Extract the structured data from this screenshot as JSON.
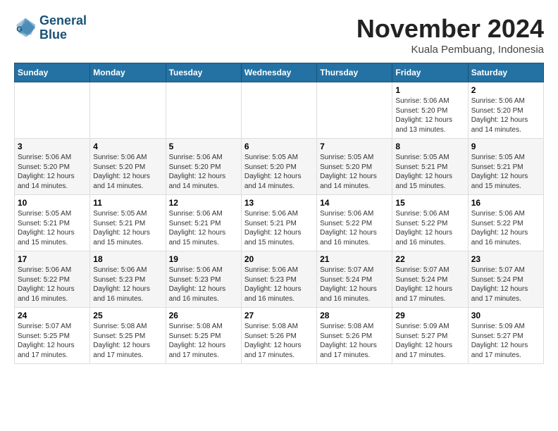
{
  "header": {
    "logo_line1": "General",
    "logo_line2": "Blue",
    "month": "November 2024",
    "location": "Kuala Pembuang, Indonesia"
  },
  "days_of_week": [
    "Sunday",
    "Monday",
    "Tuesday",
    "Wednesday",
    "Thursday",
    "Friday",
    "Saturday"
  ],
  "weeks": [
    [
      {
        "day": "",
        "info": ""
      },
      {
        "day": "",
        "info": ""
      },
      {
        "day": "",
        "info": ""
      },
      {
        "day": "",
        "info": ""
      },
      {
        "day": "",
        "info": ""
      },
      {
        "day": "1",
        "info": "Sunrise: 5:06 AM\nSunset: 5:20 PM\nDaylight: 12 hours\nand 13 minutes."
      },
      {
        "day": "2",
        "info": "Sunrise: 5:06 AM\nSunset: 5:20 PM\nDaylight: 12 hours\nand 14 minutes."
      }
    ],
    [
      {
        "day": "3",
        "info": "Sunrise: 5:06 AM\nSunset: 5:20 PM\nDaylight: 12 hours\nand 14 minutes."
      },
      {
        "day": "4",
        "info": "Sunrise: 5:06 AM\nSunset: 5:20 PM\nDaylight: 12 hours\nand 14 minutes."
      },
      {
        "day": "5",
        "info": "Sunrise: 5:06 AM\nSunset: 5:20 PM\nDaylight: 12 hours\nand 14 minutes."
      },
      {
        "day": "6",
        "info": "Sunrise: 5:05 AM\nSunset: 5:20 PM\nDaylight: 12 hours\nand 14 minutes."
      },
      {
        "day": "7",
        "info": "Sunrise: 5:05 AM\nSunset: 5:20 PM\nDaylight: 12 hours\nand 14 minutes."
      },
      {
        "day": "8",
        "info": "Sunrise: 5:05 AM\nSunset: 5:21 PM\nDaylight: 12 hours\nand 15 minutes."
      },
      {
        "day": "9",
        "info": "Sunrise: 5:05 AM\nSunset: 5:21 PM\nDaylight: 12 hours\nand 15 minutes."
      }
    ],
    [
      {
        "day": "10",
        "info": "Sunrise: 5:05 AM\nSunset: 5:21 PM\nDaylight: 12 hours\nand 15 minutes."
      },
      {
        "day": "11",
        "info": "Sunrise: 5:05 AM\nSunset: 5:21 PM\nDaylight: 12 hours\nand 15 minutes."
      },
      {
        "day": "12",
        "info": "Sunrise: 5:06 AM\nSunset: 5:21 PM\nDaylight: 12 hours\nand 15 minutes."
      },
      {
        "day": "13",
        "info": "Sunrise: 5:06 AM\nSunset: 5:21 PM\nDaylight: 12 hours\nand 15 minutes."
      },
      {
        "day": "14",
        "info": "Sunrise: 5:06 AM\nSunset: 5:22 PM\nDaylight: 12 hours\nand 16 minutes."
      },
      {
        "day": "15",
        "info": "Sunrise: 5:06 AM\nSunset: 5:22 PM\nDaylight: 12 hours\nand 16 minutes."
      },
      {
        "day": "16",
        "info": "Sunrise: 5:06 AM\nSunset: 5:22 PM\nDaylight: 12 hours\nand 16 minutes."
      }
    ],
    [
      {
        "day": "17",
        "info": "Sunrise: 5:06 AM\nSunset: 5:22 PM\nDaylight: 12 hours\nand 16 minutes."
      },
      {
        "day": "18",
        "info": "Sunrise: 5:06 AM\nSunset: 5:23 PM\nDaylight: 12 hours\nand 16 minutes."
      },
      {
        "day": "19",
        "info": "Sunrise: 5:06 AM\nSunset: 5:23 PM\nDaylight: 12 hours\nand 16 minutes."
      },
      {
        "day": "20",
        "info": "Sunrise: 5:06 AM\nSunset: 5:23 PM\nDaylight: 12 hours\nand 16 minutes."
      },
      {
        "day": "21",
        "info": "Sunrise: 5:07 AM\nSunset: 5:24 PM\nDaylight: 12 hours\nand 16 minutes."
      },
      {
        "day": "22",
        "info": "Sunrise: 5:07 AM\nSunset: 5:24 PM\nDaylight: 12 hours\nand 17 minutes."
      },
      {
        "day": "23",
        "info": "Sunrise: 5:07 AM\nSunset: 5:24 PM\nDaylight: 12 hours\nand 17 minutes."
      }
    ],
    [
      {
        "day": "24",
        "info": "Sunrise: 5:07 AM\nSunset: 5:25 PM\nDaylight: 12 hours\nand 17 minutes."
      },
      {
        "day": "25",
        "info": "Sunrise: 5:08 AM\nSunset: 5:25 PM\nDaylight: 12 hours\nand 17 minutes."
      },
      {
        "day": "26",
        "info": "Sunrise: 5:08 AM\nSunset: 5:25 PM\nDaylight: 12 hours\nand 17 minutes."
      },
      {
        "day": "27",
        "info": "Sunrise: 5:08 AM\nSunset: 5:26 PM\nDaylight: 12 hours\nand 17 minutes."
      },
      {
        "day": "28",
        "info": "Sunrise: 5:08 AM\nSunset: 5:26 PM\nDaylight: 12 hours\nand 17 minutes."
      },
      {
        "day": "29",
        "info": "Sunrise: 5:09 AM\nSunset: 5:27 PM\nDaylight: 12 hours\nand 17 minutes."
      },
      {
        "day": "30",
        "info": "Sunrise: 5:09 AM\nSunset: 5:27 PM\nDaylight: 12 hours\nand 17 minutes."
      }
    ]
  ]
}
